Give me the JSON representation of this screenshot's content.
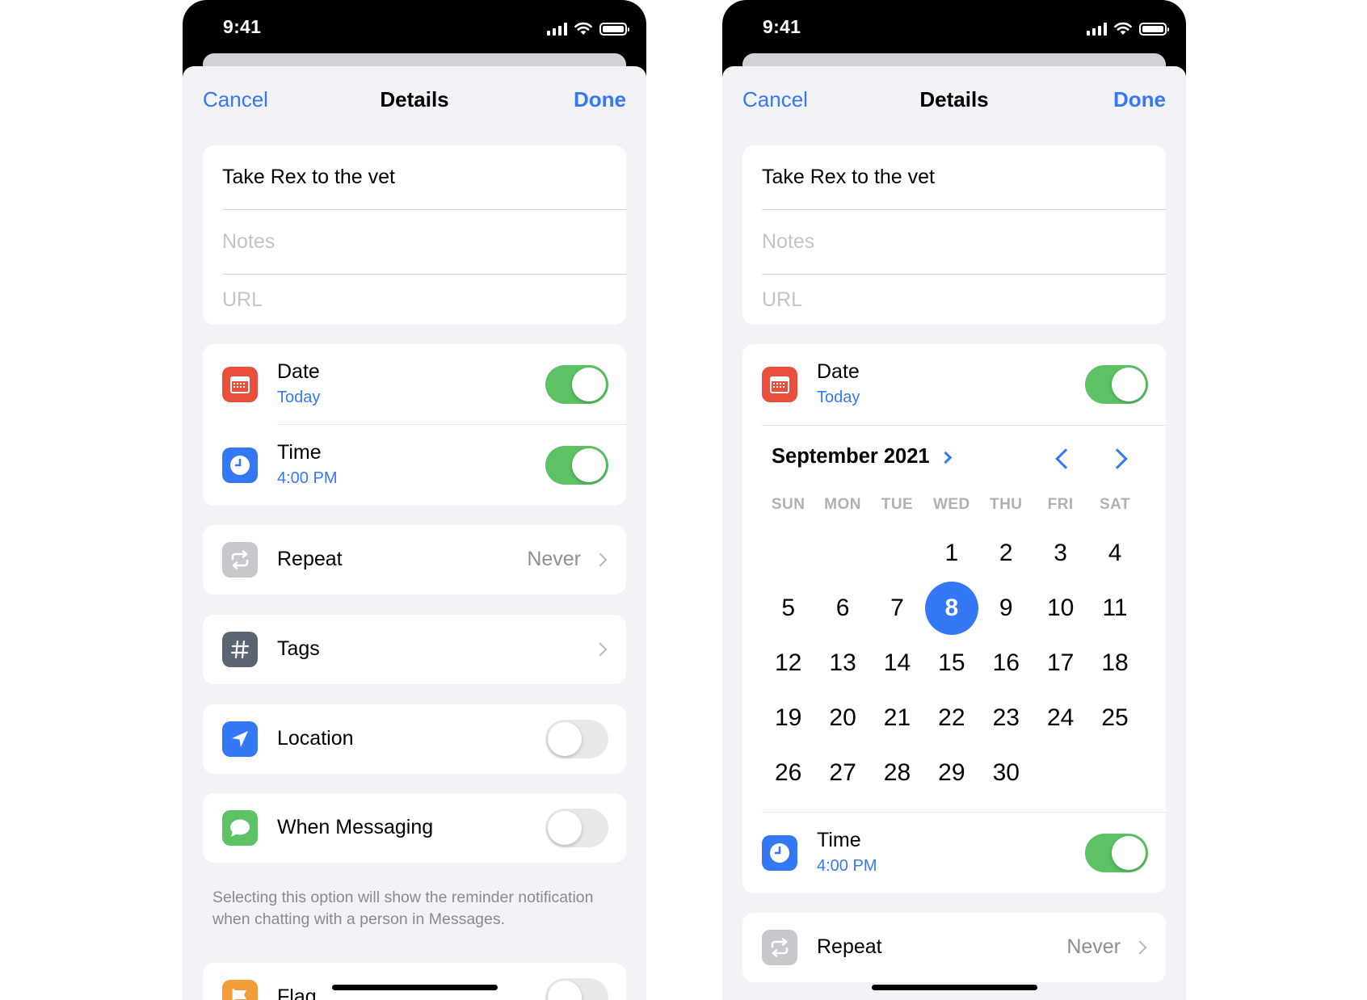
{
  "status": {
    "time": "9:41"
  },
  "nav": {
    "cancel": "Cancel",
    "title": "Details",
    "done": "Done"
  },
  "fields": {
    "title_value": "Take Rex to the vet",
    "notes_placeholder": "Notes",
    "url_placeholder": "URL"
  },
  "date": {
    "label": "Date",
    "value": "Today",
    "enabled": true
  },
  "time": {
    "label": "Time",
    "value": "4:00 PM",
    "enabled": true
  },
  "repeat": {
    "label": "Repeat",
    "value": "Never"
  },
  "tags": {
    "label": "Tags"
  },
  "location": {
    "label": "Location",
    "enabled": false
  },
  "messaging": {
    "label": "When Messaging",
    "enabled": false,
    "footer": "Selecting this option will show the reminder notification when chatting with a person in Messages."
  },
  "flag": {
    "label": "Flag",
    "enabled": false
  },
  "calendar": {
    "month_label": "September 2021",
    "weekdays": [
      "SUN",
      "MON",
      "TUE",
      "WED",
      "THU",
      "FRI",
      "SAT"
    ],
    "first_weekday_index": 3,
    "days_in_month": 30,
    "selected_day": 8
  },
  "icons": {
    "date": "calendar-icon",
    "time": "clock-icon",
    "repeat": "repeat-icon",
    "tags": "hashtag-icon",
    "location": "location-arrow-icon",
    "messaging": "message-bubble-icon",
    "flag": "flag-icon"
  },
  "colors": {
    "accent": "#3478f6",
    "toggle_on": "#5cc263",
    "date_icon": "#ea4e3d",
    "time_icon": "#3478f6",
    "repeat_icon": "#c7c7cc",
    "tags_icon": "#5b6470",
    "location_icon": "#3478f6",
    "messaging_icon": "#5cc263",
    "flag_icon": "#f29d38",
    "sheet_background": "#f2f2f7"
  }
}
